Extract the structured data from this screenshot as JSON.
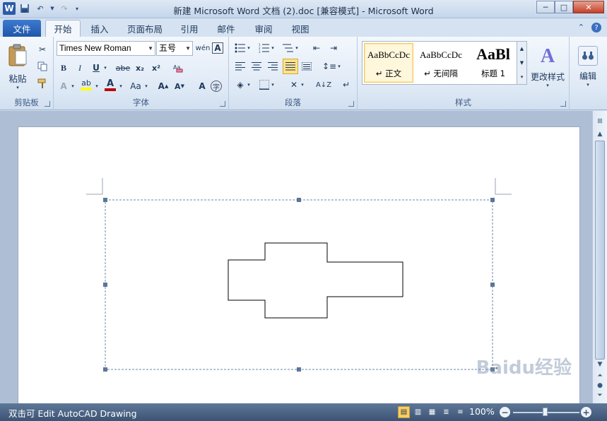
{
  "window": {
    "title": "新建 Microsoft Word 文档 (2).doc [兼容模式]  -  Microsoft Word",
    "minimize": "─",
    "maximize": "□",
    "close": "✕"
  },
  "qat": {
    "logo": "W",
    "save_icon": "save-icon",
    "undo_icon": "undo-icon",
    "redo_icon": "redo-icon"
  },
  "tabs": {
    "file": "文件",
    "items": [
      "开始",
      "插入",
      "页面布局",
      "引用",
      "邮件",
      "审阅",
      "视图"
    ],
    "active": "开始"
  },
  "ribbon": {
    "clipboard": {
      "label": "剪贴板",
      "paste": "粘贴"
    },
    "font": {
      "label": "字体",
      "font_name": "Times New Roman",
      "font_size": "五号",
      "bold": "B",
      "italic": "I",
      "underline": "U",
      "strike": "abe",
      "subscript": "x₂",
      "superscript": "x²",
      "grow": "A",
      "shrink": "A",
      "change_case": "Aa",
      "font_color_hex": "#c00000",
      "highlight_hex": "#ffff00"
    },
    "paragraph": {
      "label": "段落"
    },
    "styles": {
      "label": "样式",
      "items": [
        {
          "preview": "AaBbCcDc",
          "name": "↵ 正文"
        },
        {
          "preview": "AaBbCcDc",
          "name": "↵ 无间隔"
        },
        {
          "preview": "AaBl",
          "name": "标题 1"
        }
      ],
      "change_styles": "更改样式"
    },
    "editing": {
      "label": "编辑"
    }
  },
  "statusbar": {
    "text": "双击可 Edit AutoCAD Drawing",
    "zoom": "100%",
    "zoom_out": "−",
    "zoom_in": "+"
  },
  "watermark": "Baidu经验"
}
